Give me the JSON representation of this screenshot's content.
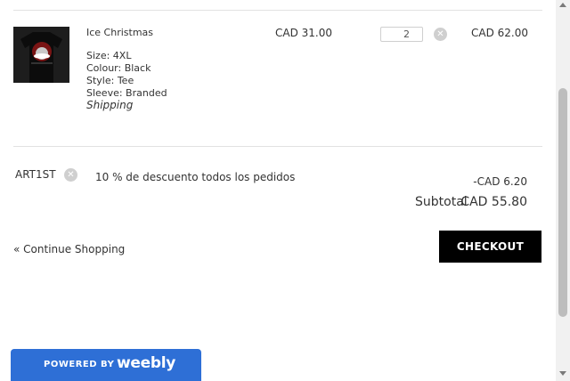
{
  "cart": {
    "item": {
      "name": "Ice Christmas",
      "options": [
        "Size: 4XL",
        "Colour: Black",
        "Style: Tee",
        "Sleeve: Branded"
      ],
      "shipping": "Shipping",
      "price": "CAD 31.00",
      "quantity": "2",
      "total": "CAD 62.00",
      "image_icon": "tshirt-thumbnail"
    },
    "coupon": {
      "code": "ART1ST",
      "description": "10 % de descuento todos los pedidos",
      "discount": "-CAD 6.20"
    },
    "subtotal_label": "Subtotal",
    "subtotal_value": "CAD 55.80",
    "continue_label": "« Continue Shopping",
    "checkout_label": "CHECKOUT",
    "remove_icon": "close-circle-icon"
  },
  "footer_badge": {
    "powered_by": "POWERED BY",
    "brand": "weebly"
  },
  "colors": {
    "checkout_bg": "#000000",
    "badge_bg": "#2e6fd6"
  }
}
